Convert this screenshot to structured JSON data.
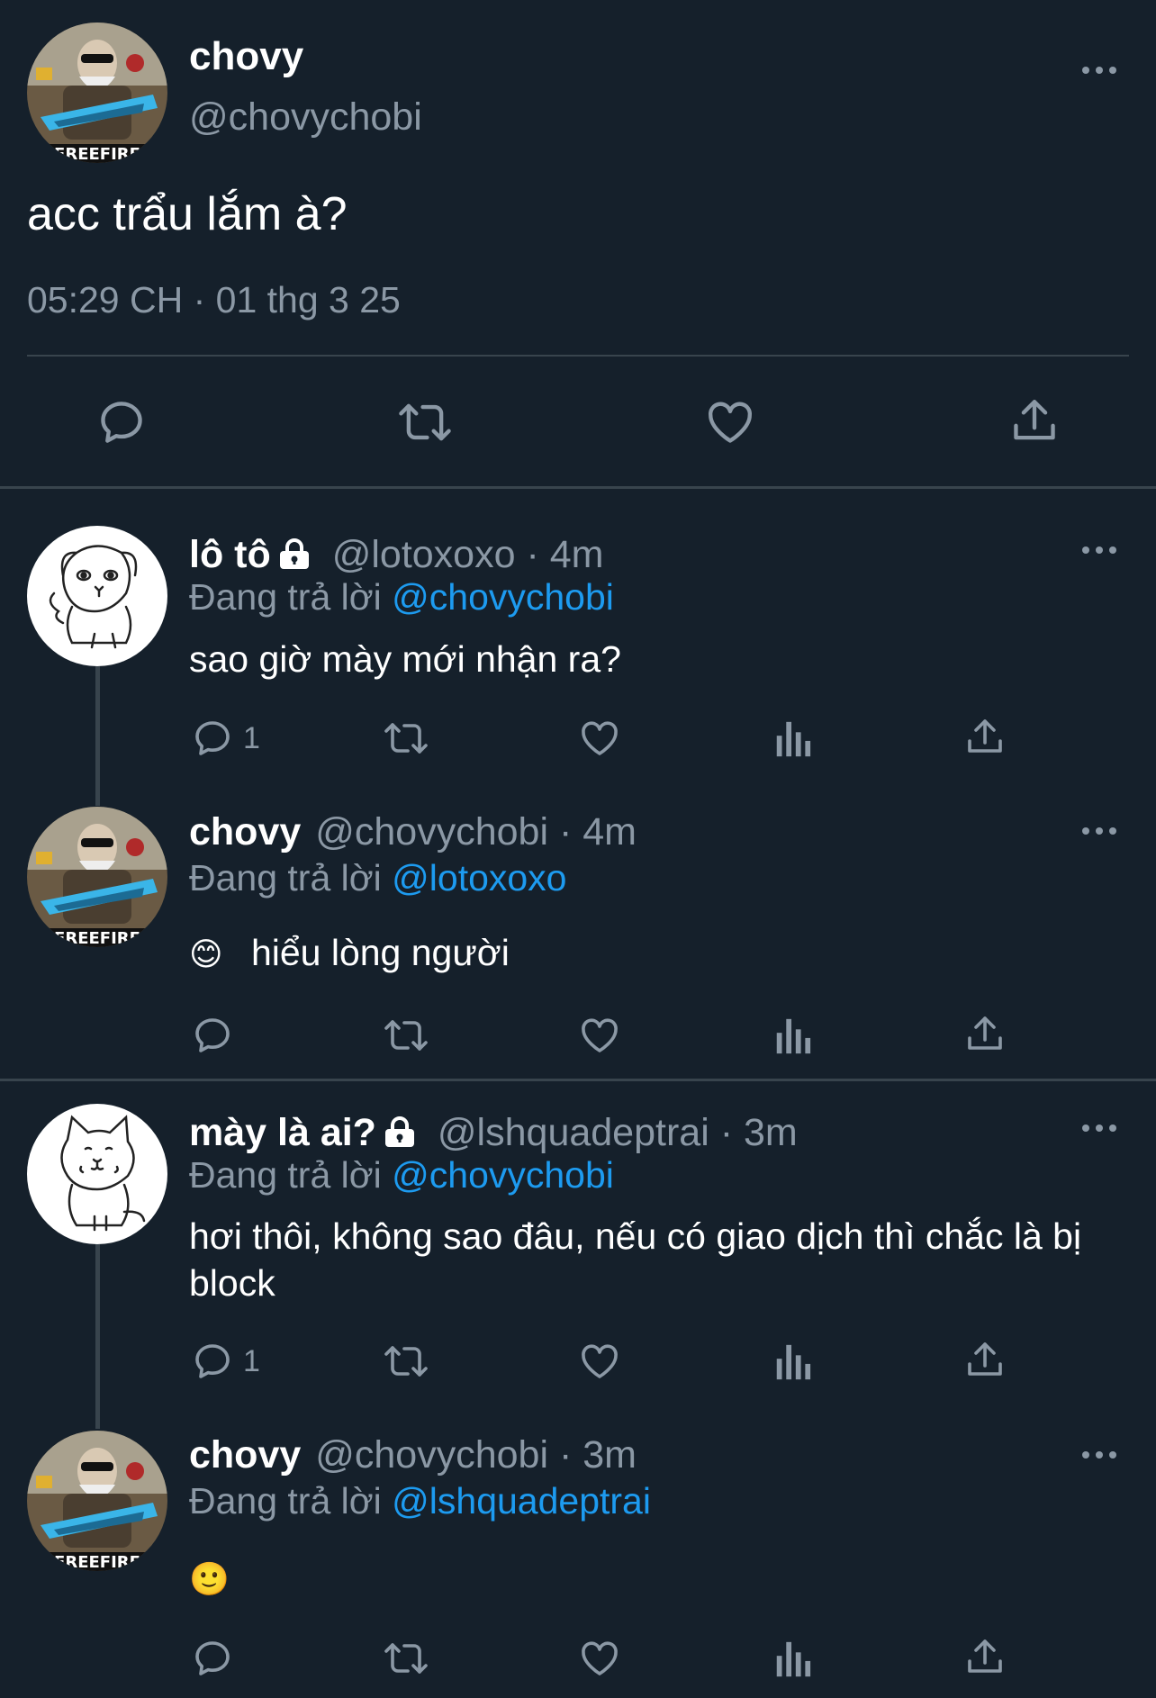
{
  "main_tweet": {
    "name": "chovy",
    "handle": "@chovychobi",
    "text": "acc trẩu lắm à?",
    "timestamp": "05:29 CH · 01 thg 3 25"
  },
  "replies": [
    {
      "name": "lô tô",
      "locked": true,
      "handle": "@lotoxoxo",
      "time": "· 4m",
      "replying_label": "Đang trả lời",
      "replying_to": "@chovychobi",
      "text": "sao giờ mày mới nhận ra?",
      "reply_count": "1"
    },
    {
      "name": "chovy",
      "handle": "@chovychobi",
      "time": "· 4m",
      "replying_label": "Đang trả lời",
      "replying_to": "@lotoxoxo",
      "emoji": "😊",
      "text": "hiểu lòng người",
      "reply_count": ""
    },
    {
      "name": "mày là ai?",
      "locked": true,
      "handle": "@lshquadeptrai",
      "time": "· 3m",
      "replying_label": "Đang trả lời",
      "replying_to": "@chovychobi",
      "text": "hơi thôi, không sao đâu, nếu có giao dịch thì chắc là bị block",
      "reply_count": "1"
    },
    {
      "name": "chovy",
      "handle": "@chovychobi",
      "time": "· 3m",
      "replying_label": "Đang trả lời",
      "replying_to": "@lshquadeptrai",
      "emoji": "🙂",
      "text": "",
      "reply_count": ""
    }
  ],
  "icons": {
    "reply": "reply-icon",
    "retweet": "retweet-icon",
    "like": "heart-icon",
    "views": "views-icon",
    "share": "share-icon",
    "more": "more-icon",
    "lock": "lock-icon"
  },
  "colors": {
    "background": "#15202b",
    "link": "#1d9bf0",
    "secondary_text": "#8b98a5",
    "divider": "#38444d"
  }
}
